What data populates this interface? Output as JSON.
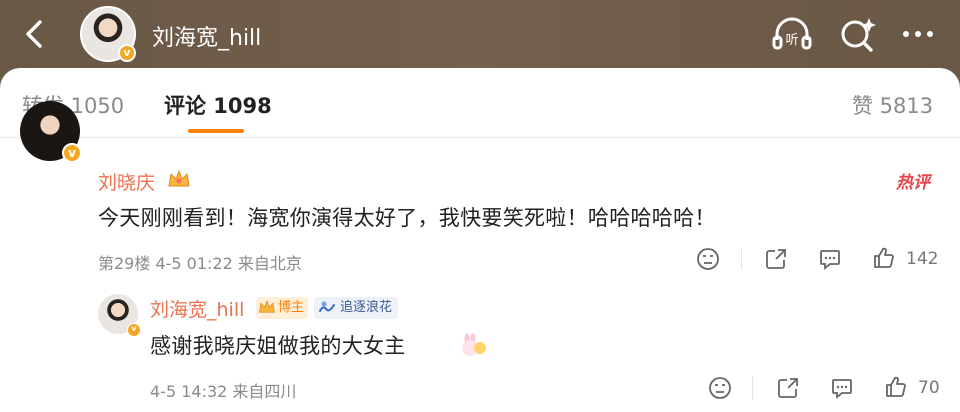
{
  "header": {
    "title": "刘海宽_hill",
    "colors": {
      "bar": "#6b5a48",
      "verified": "#f5a623"
    }
  },
  "tabs": [
    {
      "label": "转发 1050"
    },
    {
      "label": "评论 1098"
    },
    {
      "label": "赞 5813"
    }
  ],
  "comments": [
    {
      "author": "刘晓庆",
      "tag": "热评",
      "text": "今天刚刚看到！海宽你演得太好了，我快要笑死啦！哈哈哈哈哈！",
      "meta": "第29楼  4-5 01:22  来自北京",
      "likes": "142"
    }
  ],
  "reply": {
    "author": "刘海宽_hill",
    "badge_author": "博主",
    "badge_fan": "追逐浪花",
    "text": "感谢我晓庆姐做我的大女主",
    "meta": "4-5 14:32  来自四川",
    "likes": "70"
  },
  "icons": [
    "back-arrow-icon",
    "listen-icon",
    "search-sparkle-icon",
    "more-icon",
    "crown-icon",
    "dislike-face-icon",
    "share-icon",
    "comment-icon",
    "like-thumb-icon",
    "bunny-emoji-icon"
  ]
}
